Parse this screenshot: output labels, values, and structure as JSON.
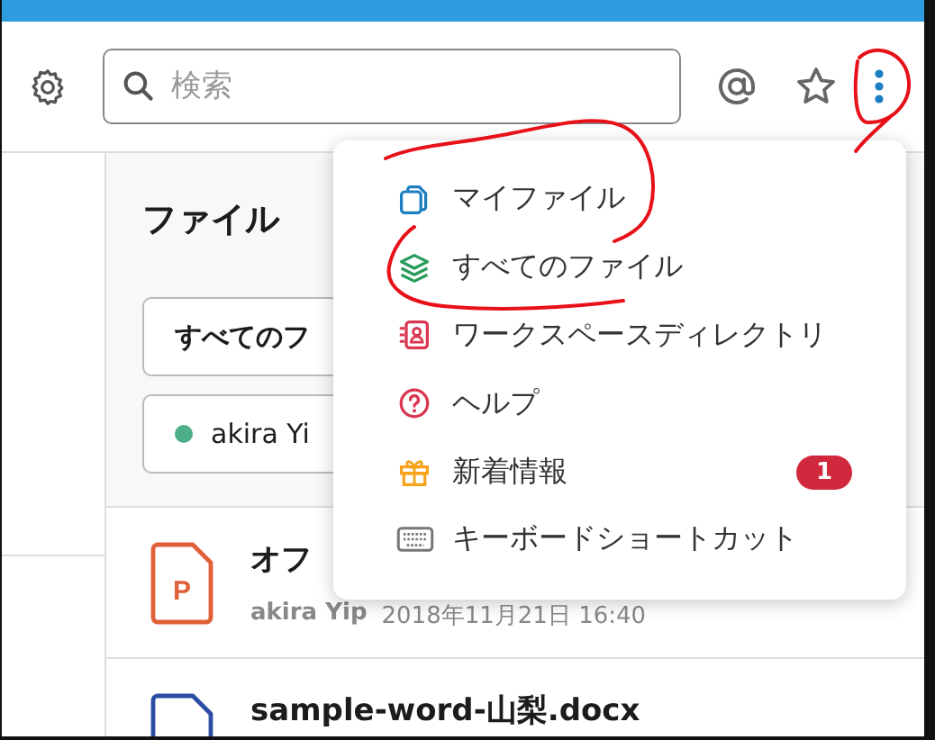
{
  "header": {
    "search": {
      "placeholder": "検索"
    }
  },
  "files_panel": {
    "title": "ファイル",
    "type_filter": "すべてのフ",
    "member_filter": {
      "name": "akira Yi",
      "online": true
    }
  },
  "files": [
    {
      "kind": "powerpoint",
      "icon_letter": "P",
      "title": "オフ",
      "owner": "akira Yip",
      "date": "2018年11月21日 16:40"
    },
    {
      "kind": "word",
      "title": "sample-word-山梨.docx"
    }
  ],
  "menu": {
    "items": [
      {
        "kind": "my_files",
        "label": "マイファイル"
      },
      {
        "kind": "all_files",
        "label": "すべてのファイル"
      },
      {
        "kind": "directory",
        "label": "ワークスペースディレクトリ"
      },
      {
        "kind": "help",
        "label": "ヘルプ"
      },
      {
        "kind": "whats_new",
        "label": "新着情報",
        "badge": "1"
      },
      {
        "kind": "shortcuts",
        "label": "キーボードショートカット"
      }
    ]
  }
}
